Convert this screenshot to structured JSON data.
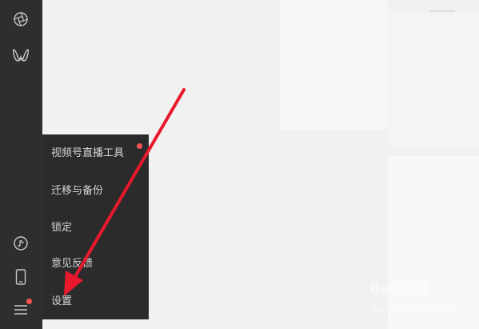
{
  "sidebar": {
    "icons": [
      {
        "name": "moments-icon"
      },
      {
        "name": "channels-icon"
      },
      {
        "name": "mini-program-icon"
      },
      {
        "name": "phone-icon"
      },
      {
        "name": "menu-icon"
      }
    ]
  },
  "menu": {
    "items": [
      {
        "label": "视频号直播工具",
        "has_dot": true
      },
      {
        "label": "迁移与备份"
      },
      {
        "label": "锁定"
      },
      {
        "label": "意见反馈"
      },
      {
        "label": "设置"
      }
    ]
  },
  "colors": {
    "sidebar_bg": "#2e2e2e",
    "popup_bg": "#2b2b2b",
    "menu_text": "#d7d7d7",
    "badge": "#fa5151",
    "annotation_arrow": "#e8192c"
  },
  "watermark": {
    "brand": "Bai 经验",
    "url": "jingyan.baidu.com"
  }
}
